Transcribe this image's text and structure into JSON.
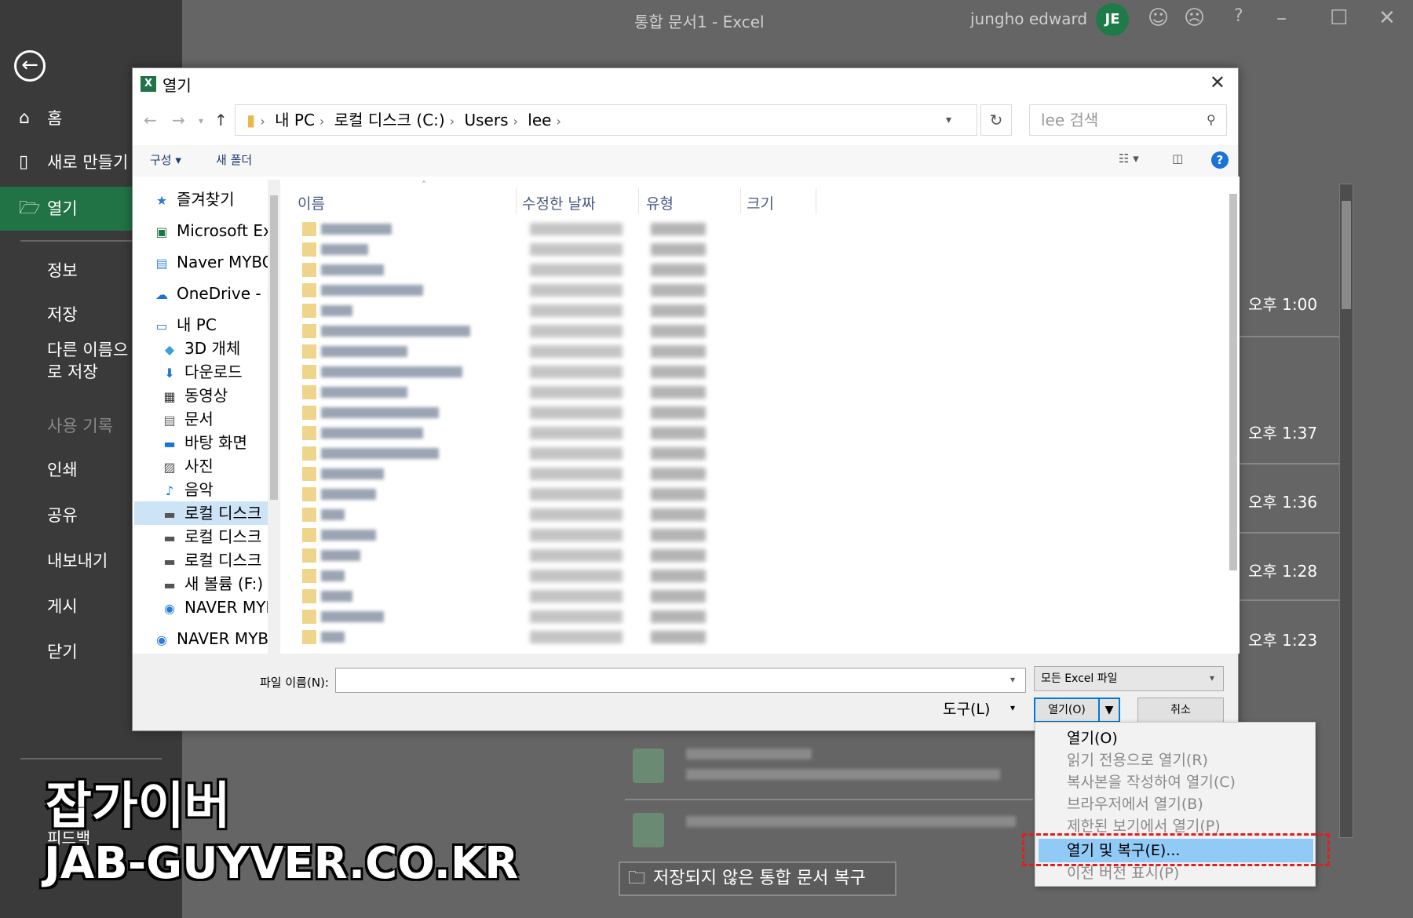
{
  "window": {
    "title": "통합 문서1  -  Excel",
    "user": "jungho edward",
    "avatar": "JE"
  },
  "backstage": {
    "nav": [
      {
        "label": "홈",
        "icon": "home-icon"
      },
      {
        "label": "새로 만들기",
        "icon": "new-doc-icon"
      },
      {
        "label": "열기",
        "icon": "folder-open-icon"
      },
      {
        "label": "정보"
      },
      {
        "label": "저장"
      },
      {
        "label": "다른 이름으로 저장"
      },
      {
        "label": "사용 기록"
      },
      {
        "label": "인쇄"
      },
      {
        "label": "공유"
      },
      {
        "label": "내보내기"
      },
      {
        "label": "게시"
      },
      {
        "label": "닫기"
      }
    ],
    "feedback": "피드백",
    "times": [
      "오후 1:00",
      "오후 1:37",
      "오후 1:36",
      "오후 1:28",
      "오후 1:23"
    ],
    "unsaved_button": "저장되지 않은 통합 문서 복구"
  },
  "dialog": {
    "title": "열기",
    "breadcrumb": [
      "내 PC",
      "로컬 디스크 (C:)",
      "Users",
      "lee"
    ],
    "search_placeholder": "lee 검색",
    "toolbar": {
      "organize": "구성 ▾",
      "new_folder": "새 폴더"
    },
    "nav_pane": [
      {
        "label": "즐겨찾기",
        "icon": "star-icon"
      },
      {
        "label": "Microsoft Ex",
        "icon": "excel-icon"
      },
      {
        "label": "Naver MYBO",
        "icon": "naver-folder-icon"
      },
      {
        "label": "OneDrive - P",
        "icon": "onedrive-icon"
      },
      {
        "label": "내 PC",
        "icon": "pc-icon"
      },
      {
        "label": "3D 개체",
        "icon": "cube-icon"
      },
      {
        "label": "다운로드",
        "icon": "download-icon"
      },
      {
        "label": "동영상",
        "icon": "video-icon"
      },
      {
        "label": "문서",
        "icon": "document-icon"
      },
      {
        "label": "바탕 화면",
        "icon": "desktop-icon"
      },
      {
        "label": "사진",
        "icon": "picture-icon"
      },
      {
        "label": "음악",
        "icon": "music-icon"
      },
      {
        "label": "로컬 디스크",
        "icon": "drive-icon"
      },
      {
        "label": "로컬 디스크",
        "icon": "drive-icon"
      },
      {
        "label": "로컬 디스크",
        "icon": "drive-icon"
      },
      {
        "label": "새 볼륨 (F:)",
        "icon": "drive-icon"
      },
      {
        "label": "NAVER MYE",
        "icon": "naver-icon"
      },
      {
        "label": "NAVER MYB(",
        "icon": "naver-icon"
      }
    ],
    "columns": [
      "이름",
      "수정한 날짜",
      "유형",
      "크기"
    ],
    "file_name_label": "파일 이름(N):",
    "file_name_value": "",
    "file_type": "모든 Excel 파일",
    "tools": "도구(L)",
    "open": "열기(O)",
    "cancel": "취소"
  },
  "open_menu": {
    "items": [
      "열기(O)",
      "읽기 전용으로 열기(R)",
      "복사본을 작성하여 열기(C)",
      "브라우저에서 열기(B)",
      "제한된 보기에서 열기(P)",
      "열기 및 복구(E)...",
      "이전 버전 표시(P)"
    ],
    "highlighted": "열기 및 복구(E)..."
  },
  "watermark": {
    "title": "잡가이버",
    "url": "JAB-GUYVER.CO.KR"
  }
}
